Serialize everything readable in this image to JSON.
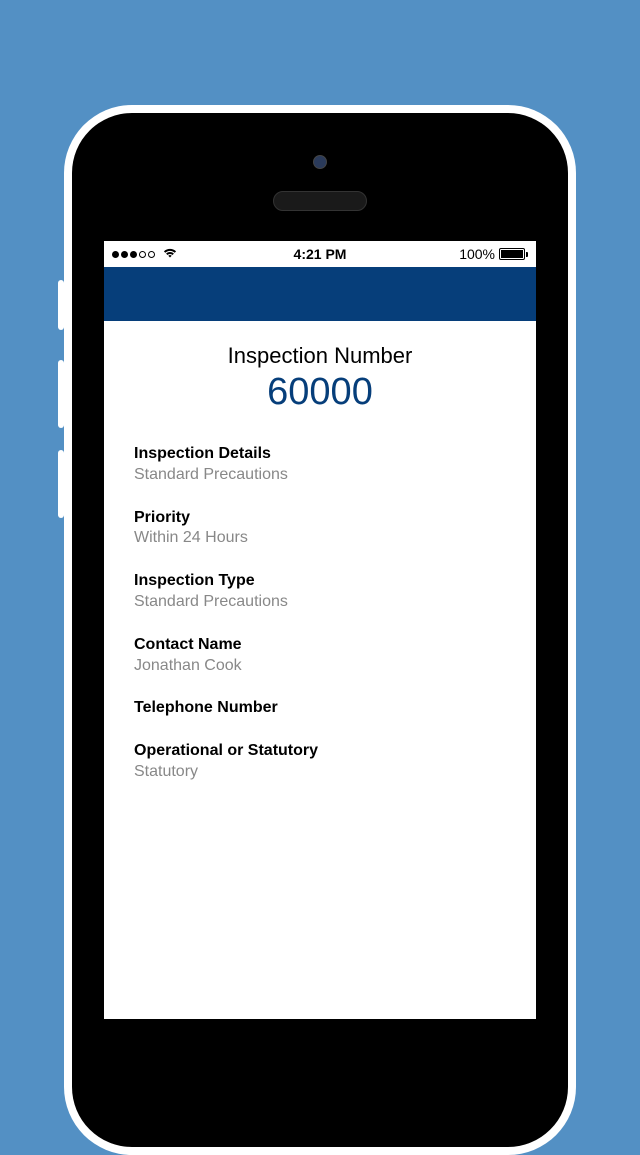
{
  "statusBar": {
    "time": "4:21 PM",
    "batteryPercent": "100%"
  },
  "header": {
    "titleLabel": "Inspection Number",
    "number": "60000"
  },
  "fields": [
    {
      "label": "Inspection Details",
      "value": "Standard Precautions"
    },
    {
      "label": "Priority",
      "value": "Within 24 Hours"
    },
    {
      "label": "Inspection Type",
      "value": "Standard Precautions"
    },
    {
      "label": "Contact Name",
      "value": "Jonathan Cook"
    },
    {
      "label": "Telephone Number",
      "value": ""
    },
    {
      "label": "Operational or Statutory",
      "value": "Statutory"
    }
  ]
}
